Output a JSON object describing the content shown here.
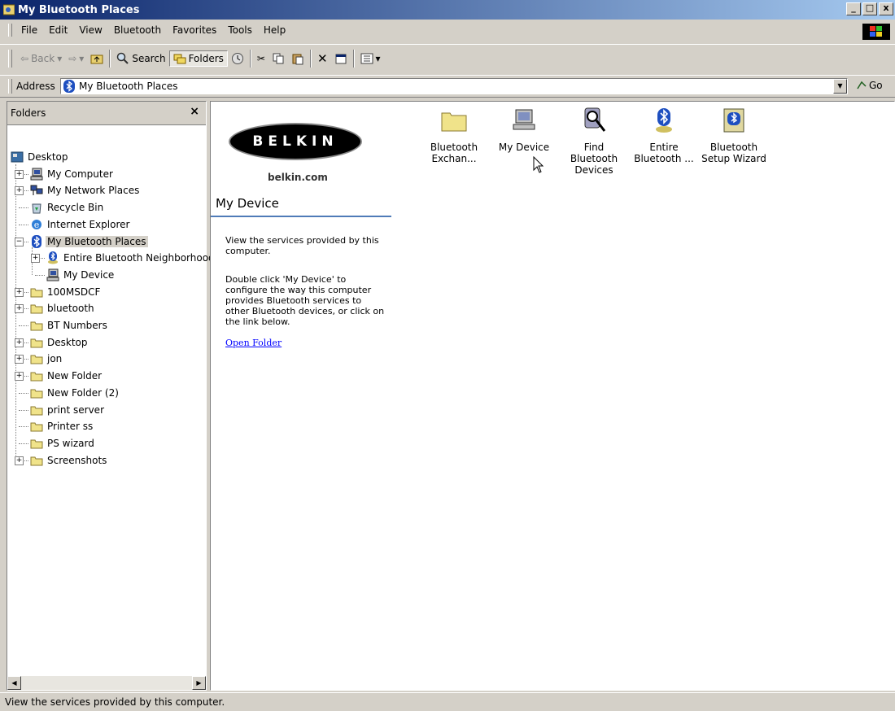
{
  "window": {
    "title": "My Bluetooth Places",
    "controls": [
      "_",
      "□",
      "x"
    ]
  },
  "menu": [
    "File",
    "Edit",
    "View",
    "Bluetooth",
    "Favorites",
    "Tools",
    "Help"
  ],
  "toolbar": {
    "back": "Back",
    "search": "Search",
    "folders": "Folders"
  },
  "address": {
    "label": "Address",
    "value": "My Bluetooth Places",
    "go": "Go"
  },
  "folders_pane": {
    "title": "Folders",
    "close": "×",
    "nodes": [
      {
        "label": "Desktop",
        "icon": "desktop-icon"
      },
      {
        "label": "My Computer",
        "icon": "computer-icon"
      },
      {
        "label": "My Network Places",
        "icon": "network-icon"
      },
      {
        "label": "Recycle Bin",
        "icon": "recycle-bin-icon"
      },
      {
        "label": "Internet Explorer",
        "icon": "internet-explorer-icon"
      },
      {
        "label": "My Bluetooth Places",
        "icon": "bluetooth-icon"
      },
      {
        "label": "Entire Bluetooth Neighborhood",
        "icon": "bluetooth-globe-icon"
      },
      {
        "label": "My Device",
        "icon": "computer-icon"
      },
      {
        "label": "100MSDCF",
        "icon": "folder-icon"
      },
      {
        "label": "bluetooth",
        "icon": "folder-icon"
      },
      {
        "label": "BT Numbers",
        "icon": "folder-icon"
      },
      {
        "label": "Desktop",
        "icon": "folder-icon"
      },
      {
        "label": "jon",
        "icon": "folder-icon"
      },
      {
        "label": "New Folder",
        "icon": "folder-icon"
      },
      {
        "label": "New Folder (2)",
        "icon": "folder-icon"
      },
      {
        "label": "print server",
        "icon": "folder-icon"
      },
      {
        "label": "Printer ss",
        "icon": "folder-icon"
      },
      {
        "label": "PS wizard",
        "icon": "folder-icon"
      },
      {
        "label": "Screenshots",
        "icon": "folder-icon"
      }
    ]
  },
  "webview": {
    "brand": "BELKIN",
    "brand_url": "belkin.com",
    "heading": "My Device",
    "para1": "View the services provided by this computer.",
    "para2": "Double click 'My Device' to configure the way this computer provides Bluetooth services to other Bluetooth devices, or click on the link below.",
    "link": "Open Folder"
  },
  "items": [
    {
      "label1": "Bluetooth",
      "label2": "Exchan...",
      "icon": "folder-icon"
    },
    {
      "label1": "My Device",
      "label2": "",
      "icon": "computer-icon"
    },
    {
      "label1": "Find Bluetooth",
      "label2": "Devices",
      "icon": "find-devices-icon"
    },
    {
      "label1": "Entire",
      "label2": "Bluetooth ...",
      "icon": "bluetooth-globe-icon"
    },
    {
      "label1": "Bluetooth",
      "label2": "Setup Wizard",
      "icon": "setup-wizard-icon"
    }
  ],
  "status": {
    "text": "View the services provided by this computer."
  }
}
